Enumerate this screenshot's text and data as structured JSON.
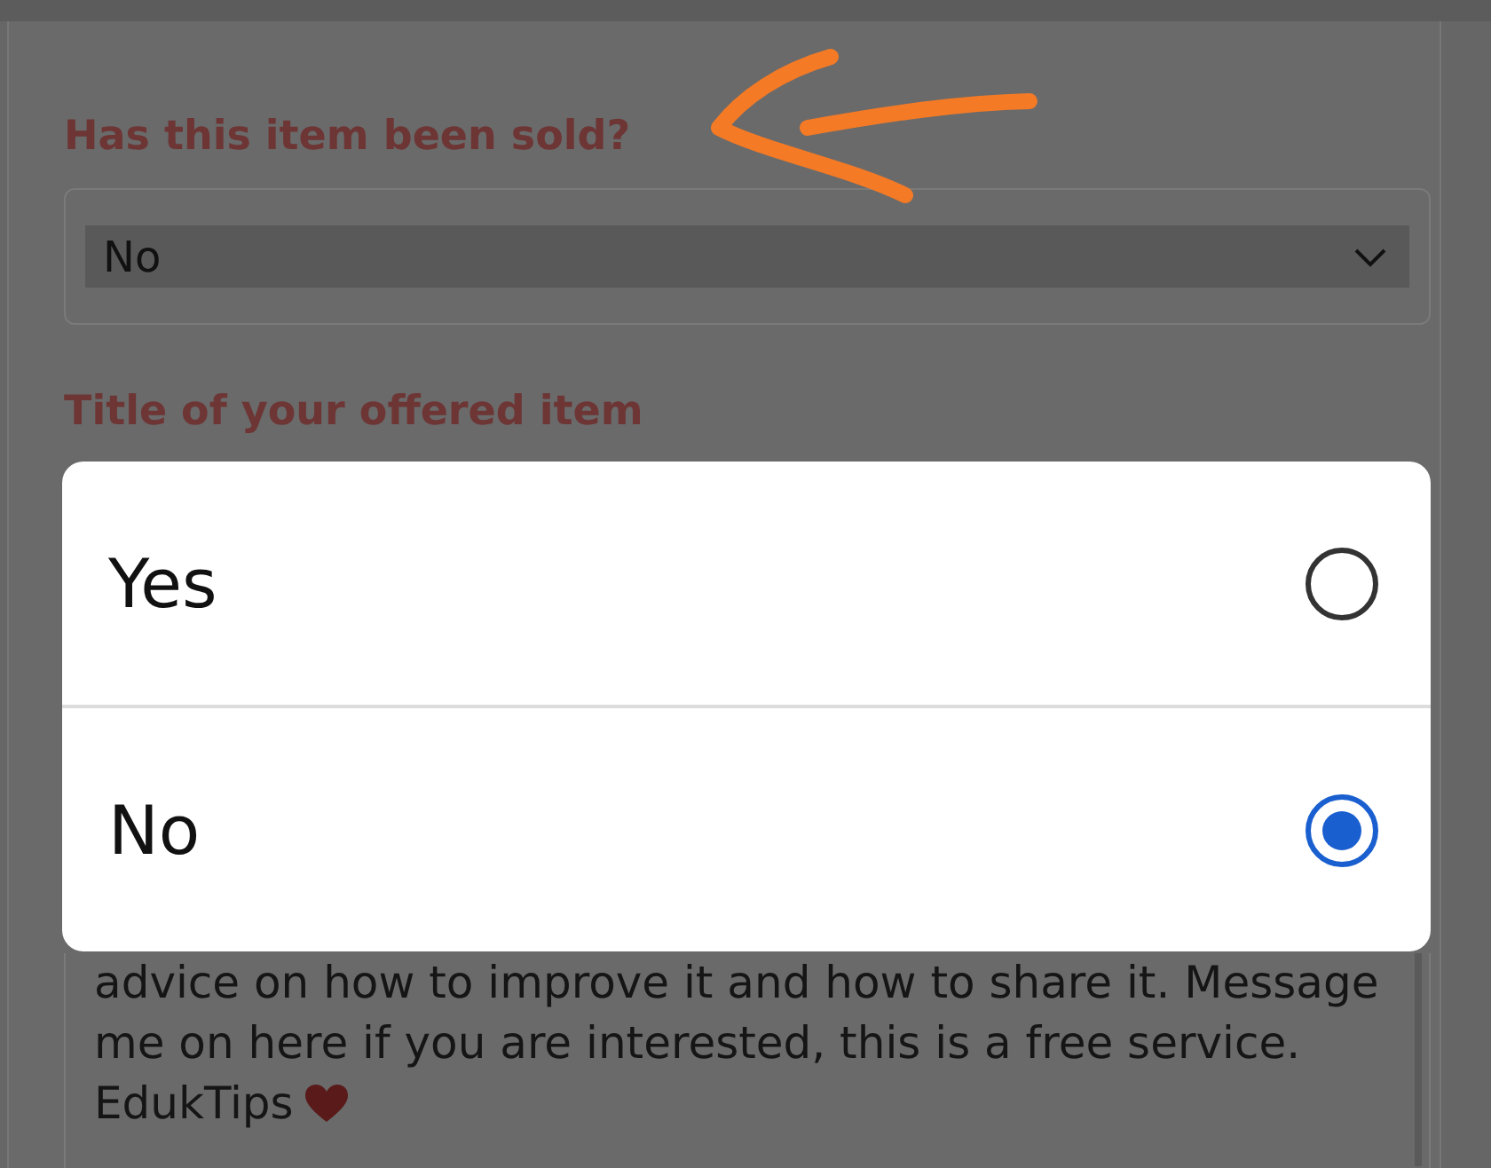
{
  "form": {
    "fields": [
      {
        "label": "Has this item been sold?",
        "kind": "select",
        "value": "No"
      },
      {
        "label": "Title of your offered item",
        "kind": "text"
      }
    ],
    "description": {
      "lines": [
        "advice on how to improve it and how to share it. Message",
        "me on here if you are interested, this is a free service.",
        "EdukTips"
      ]
    }
  },
  "dialog": {
    "options": [
      {
        "label": "Yes",
        "selected": false
      },
      {
        "label": "No",
        "selected": true
      }
    ]
  }
}
